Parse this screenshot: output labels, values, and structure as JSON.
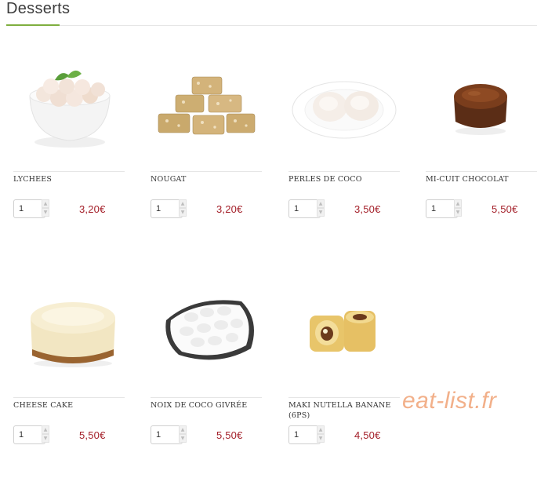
{
  "section": {
    "title": "Desserts"
  },
  "products": [
    {
      "name": "LYCHEES",
      "qty": "1",
      "price": "3,20€"
    },
    {
      "name": "NOUGAT",
      "qty": "1",
      "price": "3,20€"
    },
    {
      "name": "PERLES DE COCO",
      "qty": "1",
      "price": "3,50€"
    },
    {
      "name": "MI-CUIT CHOCOLAT",
      "qty": "1",
      "price": "5,50€"
    },
    {
      "name": "CHEESE CAKE",
      "qty": "1",
      "price": "5,50€"
    },
    {
      "name": "NOIX DE COCO GIVRÉE",
      "qty": "1",
      "price": "5,50€"
    },
    {
      "name": "MAKI NUTELLA BANANE (6PS)",
      "qty": "1",
      "price": "4,50€"
    }
  ],
  "watermark": "eat-list.fr",
  "colors": {
    "accent": "#7fae3f",
    "price": "#a4202a",
    "watermark": "#f2b08a"
  }
}
